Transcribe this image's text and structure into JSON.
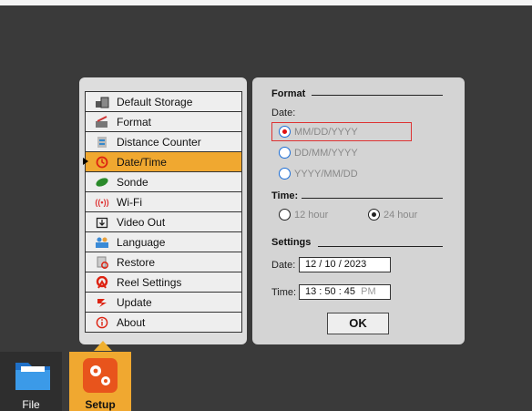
{
  "menu": {
    "items": [
      {
        "label": "Default Storage",
        "icon": "storage-icon"
      },
      {
        "label": "Format",
        "icon": "format-icon"
      },
      {
        "label": "Distance Counter",
        "icon": "distance-counter-icon"
      },
      {
        "label": "Date/Time",
        "icon": "clock-icon",
        "selected": true
      },
      {
        "label": "Sonde",
        "icon": "sonde-icon"
      },
      {
        "label": "Wi-Fi",
        "icon": "wifi-icon"
      },
      {
        "label": "Video Out",
        "icon": "video-out-icon"
      },
      {
        "label": "Language",
        "icon": "language-icon"
      },
      {
        "label": "Restore",
        "icon": "restore-icon"
      },
      {
        "label": "Reel Settings",
        "icon": "reel-icon"
      },
      {
        "label": "Update",
        "icon": "update-icon"
      },
      {
        "label": "About",
        "icon": "info-icon"
      }
    ]
  },
  "panel": {
    "format_title": "Format",
    "date_label": "Date:",
    "date_options": [
      "MM/DD/YYYY",
      "DD/MM/YYYY",
      "YYYY/MM/DD"
    ],
    "date_selected": 0,
    "time_title": "Time:",
    "time_options": [
      "12 hour",
      "24 hour"
    ],
    "time_selected": 1,
    "settings_title": "Settings",
    "date_field_label": "Date:",
    "date_value": "12 / 10 / 2023",
    "time_field_label": "Time:",
    "time_value": "13 : 50 : 45",
    "time_ampm": "PM",
    "ok_label": "OK"
  },
  "tabs": {
    "file_label": "File",
    "setup_label": "Setup"
  },
  "colors": {
    "accent": "#f0a830",
    "highlight_border": "#dd3333",
    "radio_border": "#1a6dd6"
  }
}
